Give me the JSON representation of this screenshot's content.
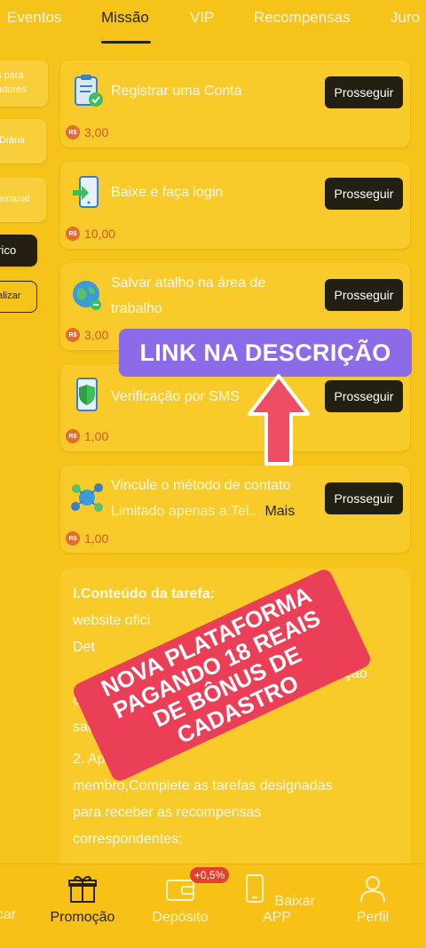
{
  "tabs": [
    "Eventos",
    "Missão",
    "VIP",
    "Recompensas",
    "Juro"
  ],
  "sidebar": {
    "items": [
      {
        "label": "os para\ngadores"
      },
      {
        "label": "o Diária"
      },
      {
        "label": "Semanal"
      },
      {
        "label": "órico"
      },
      {
        "label": "ualizar"
      }
    ]
  },
  "tasks": [
    {
      "title": "Registrar uma Conta",
      "reward": "3,00",
      "button": "Prosseguir",
      "icon": "clipboard-check-icon"
    },
    {
      "title": "Baixe e faça login",
      "reward": "10,00",
      "button": "Prosseguir",
      "icon": "phone-login-icon"
    },
    {
      "title": "Salvar atalho na área de trabalho",
      "reward": "3,00",
      "button": "Prosseguir",
      "icon": "globe-shortcut-icon"
    },
    {
      "title": "Verificação por SMS",
      "reward": "1,00",
      "button": "Prosseguir",
      "icon": "shield-phone-icon"
    },
    {
      "title": "Vincule o método de contato",
      "subtitle": "Limitado apenas a:Tel...",
      "more": "Mais",
      "reward": "1,00",
      "button": "Prosseguir",
      "icon": "contact-network-icon"
    }
  ],
  "currency_symbol": "R$",
  "content": {
    "heading": "I.Conteúdo da tarefa:",
    "lines": [
      "website ofici",
      "Det",
      "ção",
      "d                               e",
      "sacar",
      "2. Após o c",
      "membro,Complete as tarefas designadas",
      "para receber as recompensas",
      "correspondentes;"
    ]
  },
  "overlay": {
    "link_banner": "LINK NA DESCRIÇÃO",
    "promo_lines": [
      "NOVA PLATAFORMA",
      "PAGANDO 18 REAIS",
      "DE BÔNUS DE",
      "CADASTRO"
    ]
  },
  "bottom_nav": {
    "items": [
      {
        "label": "car"
      },
      {
        "label": "Promoção"
      },
      {
        "label": "Depósito"
      },
      {
        "label": "Baixar APP"
      },
      {
        "label": "Perfil"
      }
    ],
    "deposit_badge": "+0,5%"
  },
  "colors": {
    "background": "#f5c319",
    "card": "#f8cb2a",
    "button": "#231f13",
    "reward": "#d4572a",
    "link_banner": "#8c6be8",
    "promo": "#ea3f57"
  }
}
